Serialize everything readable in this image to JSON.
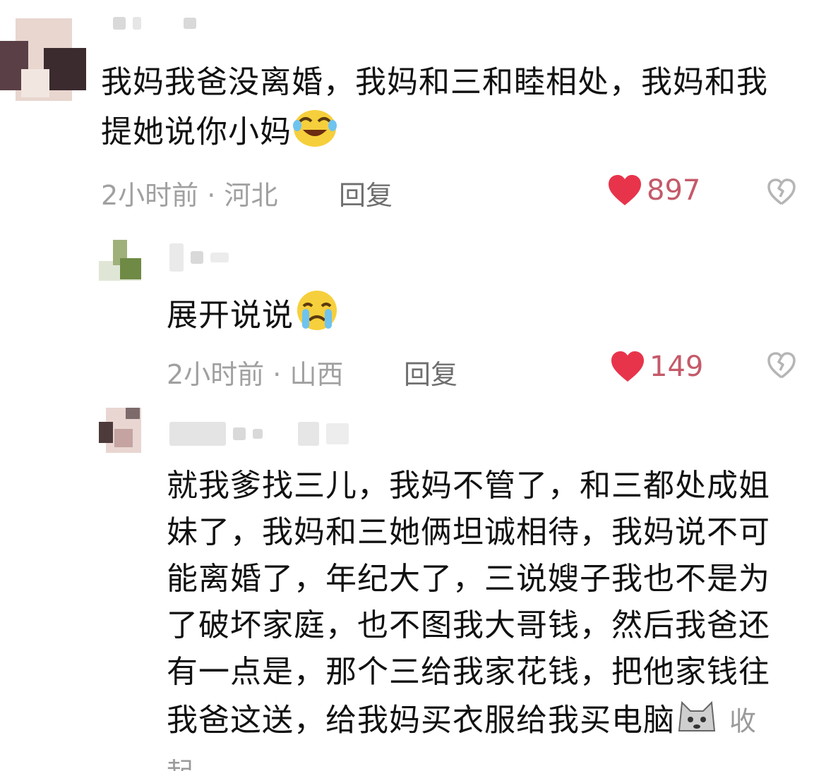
{
  "comments": [
    {
      "text": "我妈我爸没离婚，我妈和三和睦相处，我妈和我提她说你小妈",
      "time": "2小时前",
      "location": "河北",
      "reply": "回复",
      "likes": "897",
      "emoji": "laughing-crying-emoji"
    },
    {
      "text": "展开说说",
      "time": "2小时前",
      "location": "山西",
      "reply": "回复",
      "likes": "149",
      "emoji": "crying-emoji"
    },
    {
      "text": "就我爹找三儿，我妈不管了，和三都处成姐妹了，我妈和三她俩坦诚相待，我妈说不可能离婚了，年纪大了，三说嫂子我也不是为了破坏家庭，也不图我大哥钱，然后我爸还有一点是，那个三给我家花钱，把他家钱往我爸这送，给我妈买衣服给我买电脑",
      "collapse": "收起",
      "emoji": "dog-emoji"
    }
  ],
  "separator": "·",
  "colors": {
    "heart": "#e8344b",
    "like_count": "#c45a6a",
    "meta": "#a0a0a0"
  }
}
